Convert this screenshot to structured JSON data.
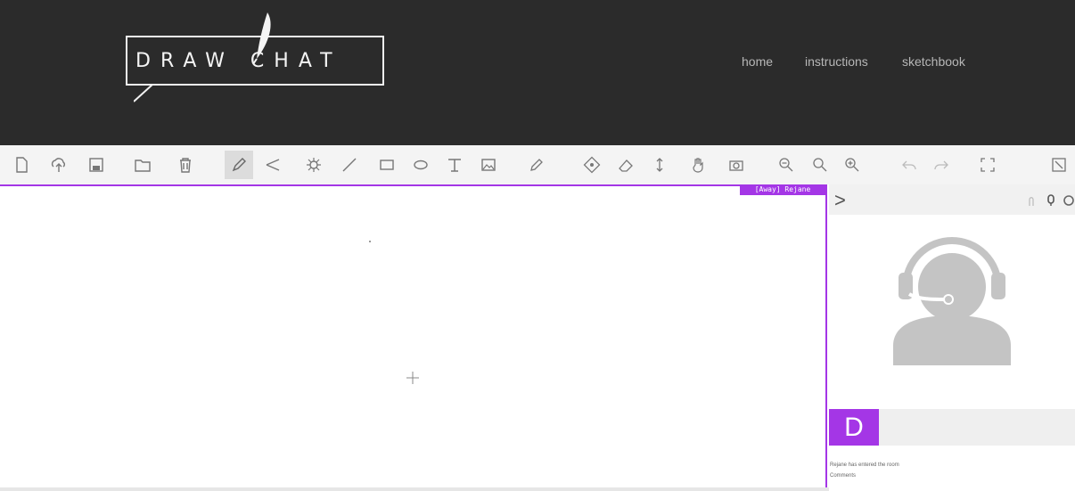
{
  "header": {
    "logo_text": "DRAW CHAT",
    "nav": [
      "home",
      "instructions",
      "sketchbook"
    ]
  },
  "toolbar": {
    "tools": [
      {
        "name": "new-page-icon"
      },
      {
        "name": "cloud-upload-icon"
      },
      {
        "name": "save-icon"
      },
      {
        "name": "folder-icon"
      },
      {
        "name": "trash-icon"
      },
      {
        "name": "pencil-icon"
      },
      {
        "name": "line-tool-icon"
      },
      {
        "name": "brush-icon"
      },
      {
        "name": "straight-line-icon"
      },
      {
        "name": "rectangle-icon"
      },
      {
        "name": "ellipse-icon"
      },
      {
        "name": "text-icon"
      },
      {
        "name": "image-icon"
      },
      {
        "name": "eyedropper-icon"
      },
      {
        "name": "fill-icon"
      },
      {
        "name": "eraser-icon"
      },
      {
        "name": "resize-icon"
      },
      {
        "name": "hand-pan-icon"
      },
      {
        "name": "camera-icon"
      },
      {
        "name": "zoom-out-icon"
      },
      {
        "name": "zoom-reset-icon"
      },
      {
        "name": "zoom-in-icon"
      },
      {
        "name": "undo-icon"
      },
      {
        "name": "redo-icon"
      },
      {
        "name": "fit-screen-icon"
      },
      {
        "name": "fullscreen-icon"
      }
    ]
  },
  "canvas": {
    "status_tag": "[Away] Rejane"
  },
  "panel": {
    "collapse_arrow": ">",
    "user_initial": "D",
    "chat": {
      "message": "Rejane has entered the room",
      "comments_label": "Comments"
    }
  },
  "theme": {
    "accent": "#a436e6",
    "header_bg": "#2b2b2b"
  }
}
